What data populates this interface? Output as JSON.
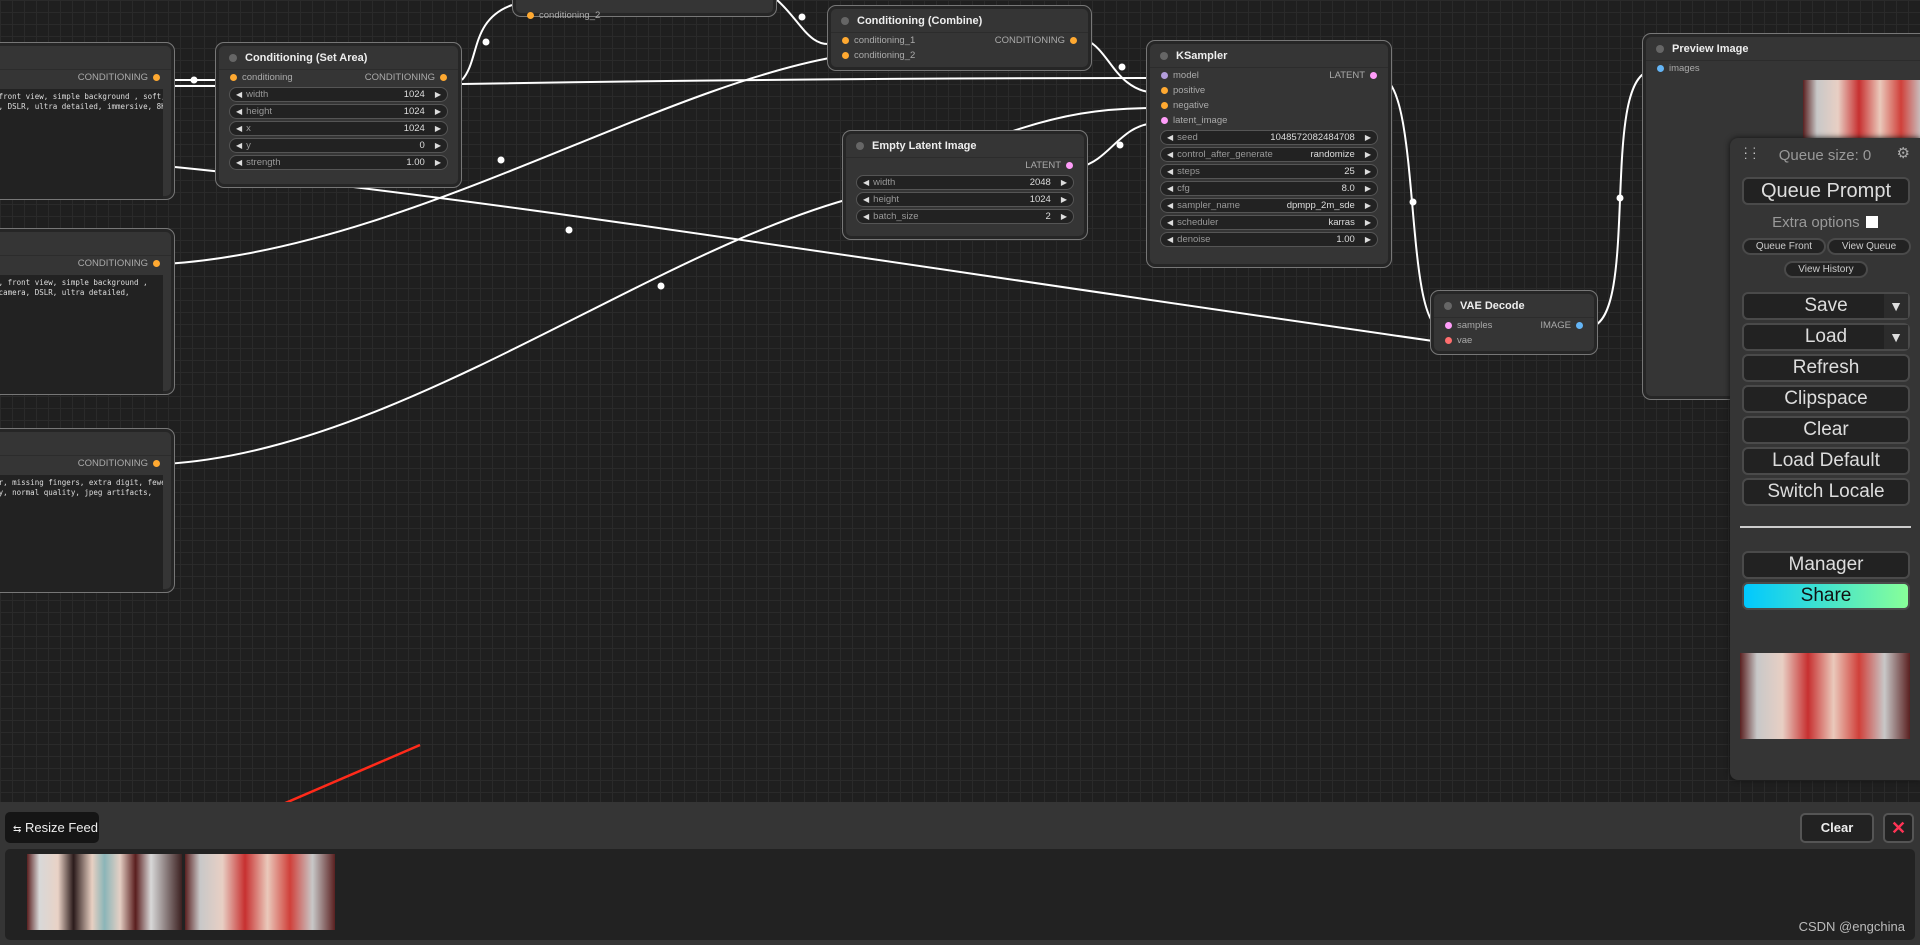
{
  "nodes": {
    "prompt1": {
      "title": "",
      "output": "CONDITIONING",
      "text": "irl, front view, simple background , soft,\namera, DSLR, ultra detailed, immersive, 8K"
    },
    "prompt2": {
      "title": "",
      "output": "CONDITIONING",
      "text": "girls, front view, simple background ,\nless camera, DSLR, ultra detailed,"
    },
    "prompt3": {
      "title": "",
      "output": "CONDITIONING",
      "text": " error, missing fingers, extra digit, fewer\nuality, normal quality, jpeg artifacts,\nk"
    },
    "topnode": {
      "title": "",
      "inputs": [
        {
          "label": "conditioning_2",
          "color": "#ffa931"
        }
      ]
    },
    "setarea": {
      "title": "Conditioning (Set Area)",
      "inputs": [
        {
          "label": "conditioning",
          "color": "#ffa931"
        }
      ],
      "output": "CONDITIONING",
      "outColor": "#ffa931",
      "widgets": [
        {
          "label": "width",
          "value": "1024"
        },
        {
          "label": "height",
          "value": "1024"
        },
        {
          "label": "x",
          "value": "1024"
        },
        {
          "label": "y",
          "value": "0"
        },
        {
          "label": "strength",
          "value": "1.00"
        }
      ]
    },
    "combine": {
      "title": "Conditioning (Combine)",
      "inputs": [
        {
          "label": "conditioning_1",
          "color": "#ffa931"
        },
        {
          "label": "conditioning_2",
          "color": "#ffa931"
        }
      ],
      "output": "CONDITIONING",
      "outColor": "#ffa931"
    },
    "ksampler": {
      "title": "KSampler",
      "inputs": [
        {
          "label": "model",
          "color": "#b39ddb"
        },
        {
          "label": "positive",
          "color": "#ffa931"
        },
        {
          "label": "negative",
          "color": "#ffa931"
        },
        {
          "label": "latent_image",
          "color": "#ff9cf9"
        }
      ],
      "output": "LATENT",
      "outColor": "#ff9cf9",
      "widgets": [
        {
          "label": "seed",
          "value": "1048572082484708"
        },
        {
          "label": "control_after_generate",
          "value": "randomize"
        },
        {
          "label": "steps",
          "value": "25"
        },
        {
          "label": "cfg",
          "value": "8.0"
        },
        {
          "label": "sampler_name",
          "value": "dpmpp_2m_sde"
        },
        {
          "label": "scheduler",
          "value": "karras"
        },
        {
          "label": "denoise",
          "value": "1.00"
        }
      ]
    },
    "latent": {
      "title": "Empty Latent Image",
      "inputs": [],
      "output": "LATENT",
      "outColor": "#ff9cf9",
      "widgets": [
        {
          "label": "width",
          "value": "2048"
        },
        {
          "label": "height",
          "value": "1024"
        },
        {
          "label": "batch_size",
          "value": "2"
        }
      ]
    },
    "vae": {
      "title": "VAE Decode",
      "inputs": [
        {
          "label": "samples",
          "color": "#ff9cf9"
        },
        {
          "label": "vae",
          "color": "#ff6e6e"
        }
      ],
      "output": "IMAGE",
      "outColor": "#64b5f6"
    },
    "preview": {
      "title": "Preview Image",
      "inputs": [
        {
          "label": "images",
          "color": "#64b5f6"
        }
      ]
    }
  },
  "panel": {
    "queue_size": "Queue size: 0",
    "queue_prompt": "Queue Prompt",
    "extra_options": "Extra options",
    "extra_options_checked": false,
    "queue_front": "Queue Front",
    "view_queue": "View Queue",
    "view_history": "View History",
    "save": "Save",
    "load": "Load",
    "refresh": "Refresh",
    "clipspace": "Clipspace",
    "clear": "Clear",
    "load_default": "Load Default",
    "switch_locale": "Switch Locale",
    "manager": "Manager",
    "share": "Share",
    "dropdown_glyph": "▼"
  },
  "feed": {
    "resize_feed": "Resize Feed",
    "clear": "Clear",
    "close_glyph": "✕",
    "close_color": "#ff3355"
  },
  "watermark": "CSDN @engchina",
  "annotation_arrow_color": "#ff2a1a"
}
